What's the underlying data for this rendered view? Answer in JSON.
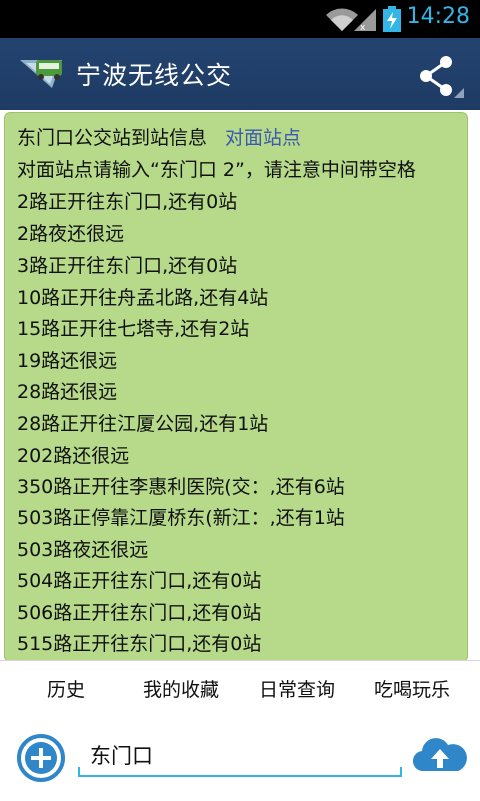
{
  "status_bar": {
    "time": "14:28",
    "icons": [
      "wifi-icon",
      "signal-icon",
      "battery-charging-icon"
    ]
  },
  "action_bar": {
    "title": "宁波无线公交",
    "logo_icon": "bus-logo-icon",
    "share_icon": "share-icon"
  },
  "info": {
    "header": "东门口公交站到站信息",
    "opposite_link": "对面站点",
    "hint": "对面站点请输入“东门口 2”，请注意中间带空格",
    "lines": [
      "2路正开往东门口,还有0站",
      "2路夜还很远",
      "3路正开往东门口,还有0站",
      "10路正开往舟孟北路,还有4站",
      "15路正开往七塔寺,还有2站",
      "19路还很远",
      "28路还很远",
      "28路正开往江厦公园,还有1站",
      "202路还很远",
      "350路正开往李惠利医院(交：,还有6站",
      "503路正停靠江厦桥东(新江：,还有1站",
      "503路夜还很远",
      "504路正开往东门口,还有0站",
      "506路正开往东门口,还有0站",
      "515路正开往东门口,还有0站"
    ]
  },
  "tabs": [
    "历史",
    "我的收藏",
    "日常查询",
    "吃喝玩乐"
  ],
  "search": {
    "value": "东门口",
    "add_icon": "plus-circle-icon",
    "upload_icon": "cloud-upload-icon"
  },
  "colors": {
    "accent": "#33b5e5",
    "action_bar": "#24436f",
    "panel": "#b6d98a",
    "link": "#3c59b0"
  }
}
